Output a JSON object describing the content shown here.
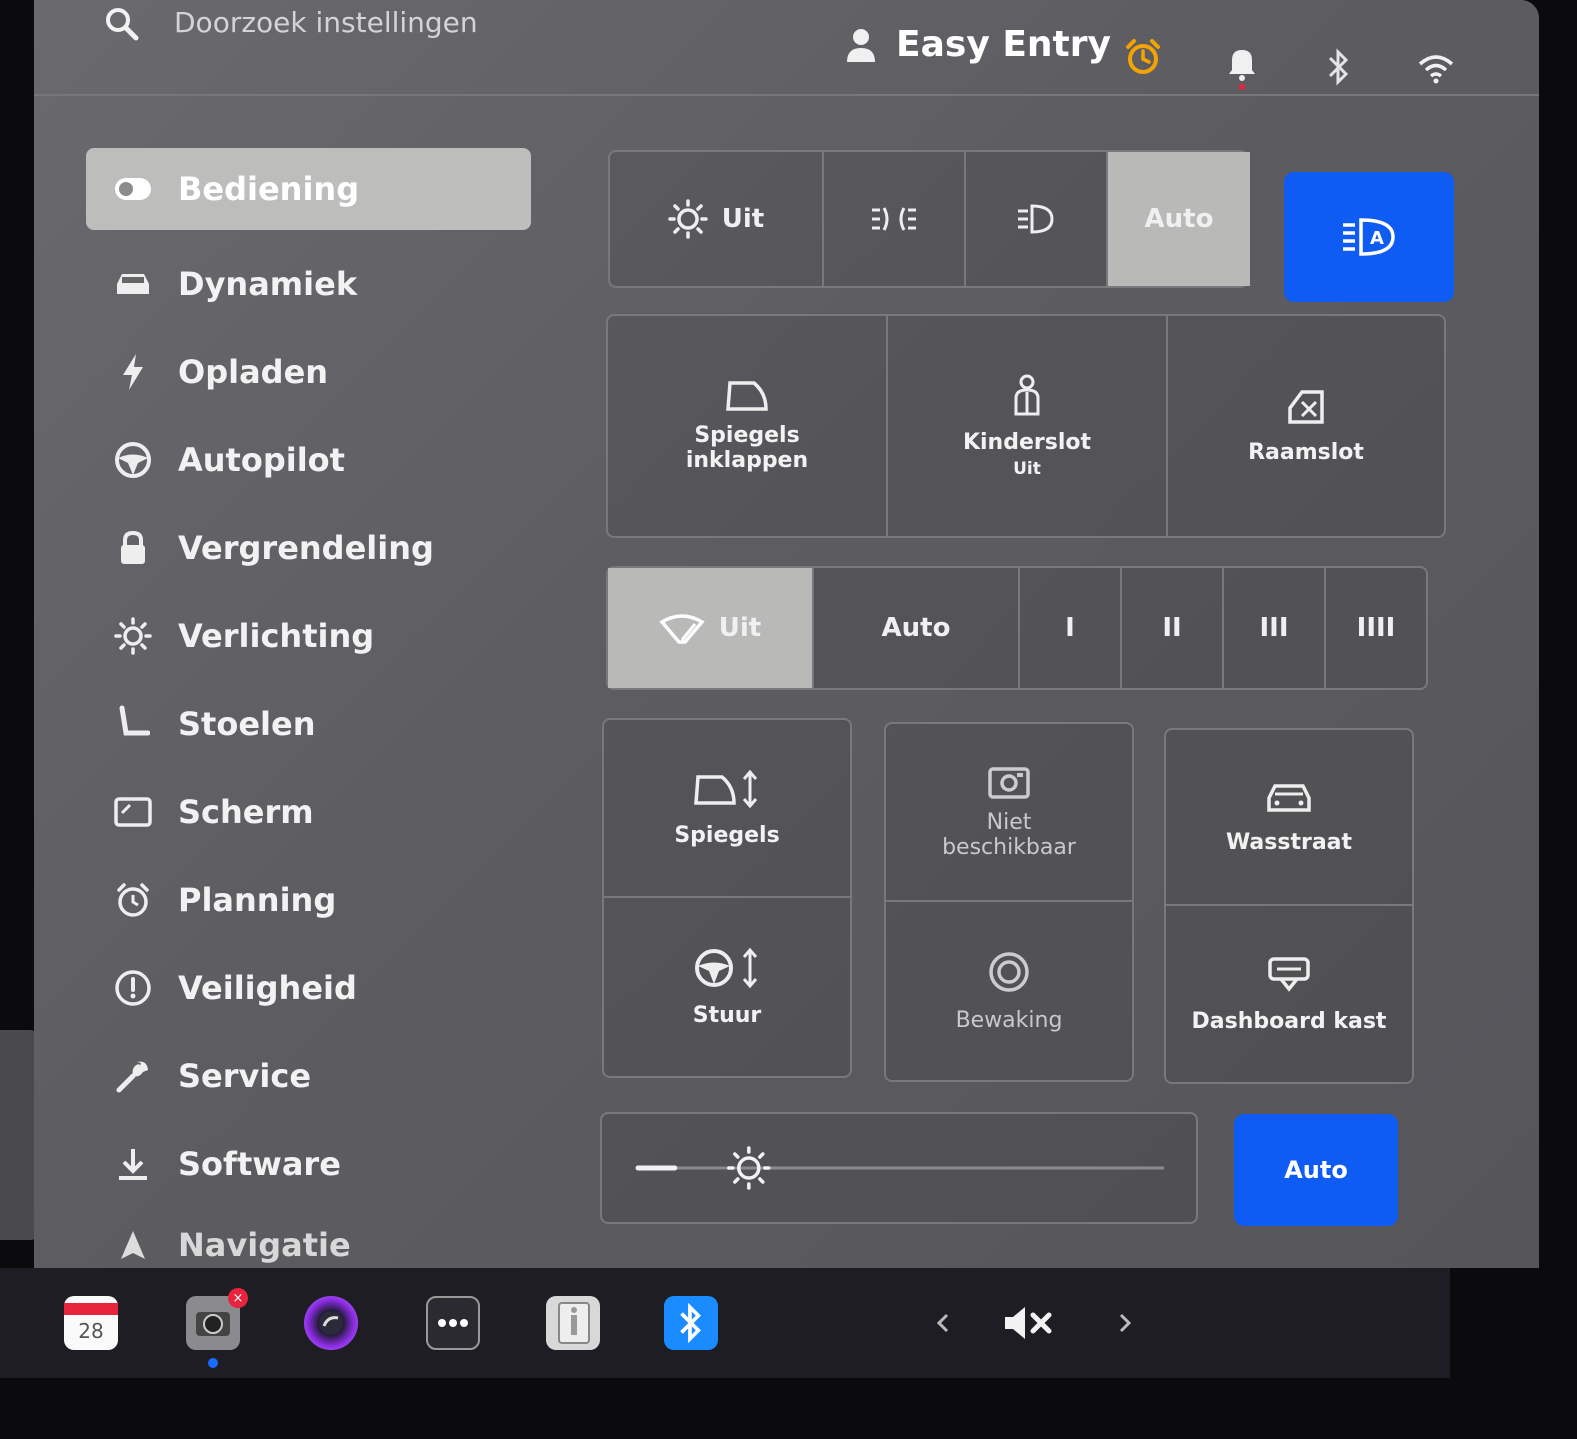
{
  "search": {
    "placeholder": "Doorzoek instellingen"
  },
  "profile": {
    "name": "Easy Entry"
  },
  "colors": {
    "accent_blue": "#0f5cf5",
    "alarm_orange": "#f5a300",
    "selected_gray": "#b9b9b8"
  },
  "sidebar": {
    "items": [
      {
        "label": "Bediening",
        "icon": "toggle-icon"
      },
      {
        "label": "Dynamiek",
        "icon": "car-icon"
      },
      {
        "label": "Opladen",
        "icon": "bolt-icon"
      },
      {
        "label": "Autopilot",
        "icon": "steering-wheel-icon"
      },
      {
        "label": "Vergrendeling",
        "icon": "lock-icon"
      },
      {
        "label": "Verlichting",
        "icon": "sun-icon"
      },
      {
        "label": "Stoelen",
        "icon": "seat-icon"
      },
      {
        "label": "Scherm",
        "icon": "display-icon"
      },
      {
        "label": "Planning",
        "icon": "alarm-clock-icon"
      },
      {
        "label": "Veiligheid",
        "icon": "warning-icon"
      },
      {
        "label": "Service",
        "icon": "wrench-icon"
      },
      {
        "label": "Software",
        "icon": "download-icon"
      },
      {
        "label": "Navigatie",
        "icon": "navigation-icon"
      }
    ]
  },
  "lights": {
    "off_label": "Uit",
    "auto_label": "Auto",
    "selected": "Auto"
  },
  "tiles_row1": {
    "mirrors_fold": "Spiegels inklappen",
    "child_lock": "Kinderslot",
    "child_lock_state": "Uit",
    "window_lock": "Raamslot"
  },
  "wipers": {
    "off_label": "Uit",
    "auto_label": "Auto",
    "speeds": [
      "I",
      "II",
      "III",
      "IIII"
    ],
    "selected": "Uit"
  },
  "tiles_grid": {
    "mirrors": "Spiegels",
    "unavailable": "Niet beschikbaar",
    "car_wash": "Wasstraat",
    "steering": "Stuur",
    "sentry": "Bewaking",
    "glovebox": "Dashboard kast"
  },
  "brightness": {
    "auto_label": "Auto",
    "level": 0.07
  },
  "taskbar": {
    "calendar_day": "28"
  }
}
